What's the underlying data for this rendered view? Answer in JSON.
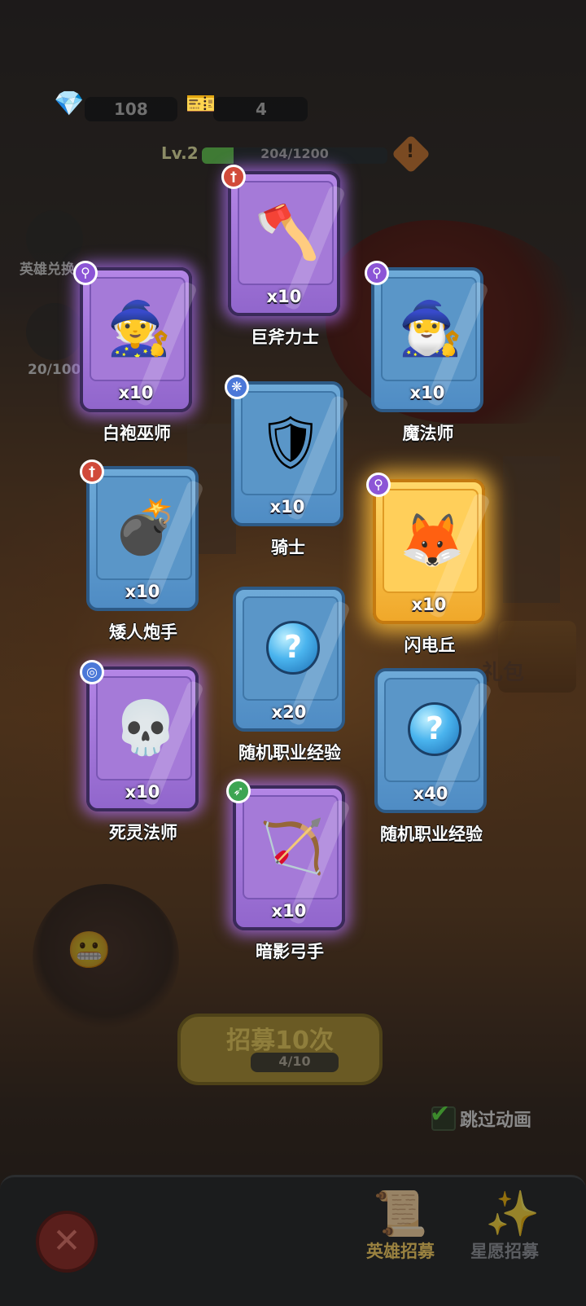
{
  "resources": {
    "gems": "108",
    "tickets": "4"
  },
  "level": {
    "label": "Lv.2",
    "xp_text": "204/1200",
    "xp_fraction": 0.17
  },
  "side": {
    "hero_exchange": "英雄兑换",
    "stars": "20/100"
  },
  "chest_label": "礼包",
  "cards": [
    {
      "name": "巨斧力士",
      "qty": "x10",
      "rarity": "purple",
      "class_icon": "sword-class-icon",
      "portrait": "barbarian-axe-icon"
    },
    {
      "name": "白袍巫师",
      "qty": "x10",
      "rarity": "purple",
      "class_icon": "staff-class-icon",
      "portrait": "white-wizard-icon"
    },
    {
      "name": "魔法师",
      "qty": "x10",
      "rarity": "blue",
      "class_icon": "staff-class-icon",
      "portrait": "blue-mage-icon"
    },
    {
      "name": "骑士",
      "qty": "x10",
      "rarity": "blue",
      "class_icon": "paw-class-icon",
      "portrait": "knight-icon"
    },
    {
      "name": "矮人炮手",
      "qty": "x10",
      "rarity": "blue",
      "class_icon": "sword-class-icon",
      "portrait": "dwarf-gunner-icon"
    },
    {
      "name": "闪电丘",
      "qty": "x10",
      "rarity": "gold",
      "class_icon": "staff-class-icon",
      "portrait": "lightning-fox-girl-icon"
    },
    {
      "name": "随机职业经验",
      "qty": "x20",
      "rarity": "blue",
      "class_icon": "",
      "portrait": "question-orb-icon"
    },
    {
      "name": "死灵法师",
      "qty": "x10",
      "rarity": "purple",
      "class_icon": "spiral-class-icon",
      "portrait": "necromancer-icon"
    },
    {
      "name": "随机职业经验",
      "qty": "x40",
      "rarity": "blue",
      "class_icon": "",
      "portrait": "question-orb-icon"
    },
    {
      "name": "暗影弓手",
      "qty": "x10",
      "rarity": "purple",
      "class_icon": "bow-class-icon",
      "portrait": "shadow-archer-icon"
    }
  ],
  "recruit": {
    "button_label": "招募10次",
    "count": "4/10"
  },
  "skip_animation": {
    "label": "跳过动画",
    "checked": true
  },
  "tabs": {
    "hero_recruit": "英雄招募",
    "wish_recruit": "星愿招募"
  },
  "colors": {
    "blue_card": "#5a96c8",
    "purple_card": "#a57ad8",
    "gold_card": "#ffcf5a",
    "active_tab": "#c9a53a"
  }
}
